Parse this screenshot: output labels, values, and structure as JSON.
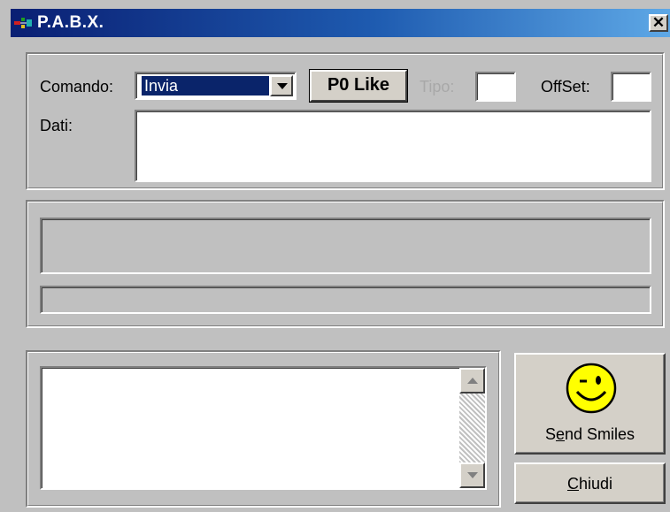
{
  "window": {
    "title": "P.A.B.X.",
    "close_label": "✕"
  },
  "command_panel": {
    "comando_label": "Comando:",
    "comando_value": "Invia",
    "p0_button_label": "P0 Like",
    "tipo_label": "Tipo:",
    "tipo_value": "",
    "offset_label": "OffSet:",
    "offset_value": "",
    "dati_label": "Dati:",
    "dati_value": ""
  },
  "status_panel": {
    "display_value": "",
    "bar_value": ""
  },
  "log_panel": {
    "log_value": ""
  },
  "buttons": {
    "send_smiles_prefix": "S",
    "send_smiles_mnemonic": "e",
    "send_smiles_suffix": "nd Smiles",
    "chiudi_mnemonic": "C",
    "chiudi_suffix": "hiudi"
  },
  "icons": {
    "app": "network-icon",
    "smiley": "smiley-face-icon"
  },
  "colors": {
    "title_gradient_start": "#0a1f73",
    "title_gradient_end": "#5ea8e6",
    "selection": "#0a246a",
    "smiley_face": "#ffff00",
    "disabled_text": "#a8a8a8"
  }
}
